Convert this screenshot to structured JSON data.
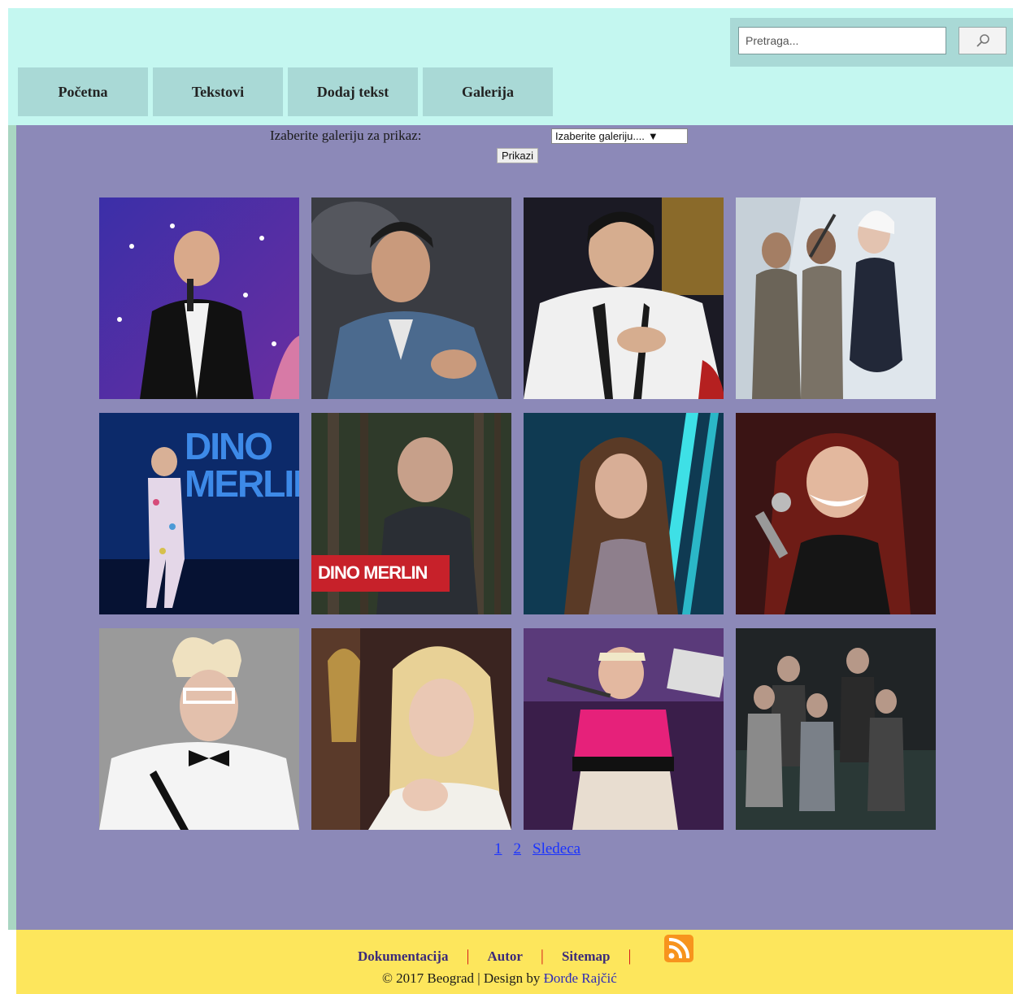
{
  "search": {
    "placeholder": "Pretraga..."
  },
  "nav": {
    "items": [
      {
        "label": "Početna"
      },
      {
        "label": "Tekstovi"
      },
      {
        "label": "Dodaj tekst"
      },
      {
        "label": "Galerija"
      }
    ]
  },
  "gallery_picker": {
    "label": "Izaberite galeriju za prikaz:",
    "selected": "Izaberite galeriju....",
    "button_label": "Prikazi"
  },
  "gallery": {
    "tiles": [
      {
        "caption": ""
      },
      {
        "caption": ""
      },
      {
        "caption": ""
      },
      {
        "caption": ""
      },
      {
        "caption": "DINO MERLIN"
      },
      {
        "caption": "DINO MERLIN"
      },
      {
        "caption": ""
      },
      {
        "caption": ""
      },
      {
        "caption": ""
      },
      {
        "caption": ""
      },
      {
        "caption": ""
      },
      {
        "caption": ""
      }
    ]
  },
  "pagination": {
    "page1": "1",
    "page2": "2",
    "next": "Sledeca"
  },
  "footer": {
    "links": [
      "Dokumentacija",
      "Autor",
      "Sitemap"
    ],
    "separator": "|",
    "copyright_prefix": "© 2017 Beograd | Design by ",
    "author": "Đorđe Rajčić"
  },
  "colors": {
    "header_bg": "#c4f7f0",
    "nav_bg": "#a9d9d6",
    "main_bg": "#8c89b8",
    "footer_bg": "#fde65c",
    "link": "#1a33ff"
  }
}
